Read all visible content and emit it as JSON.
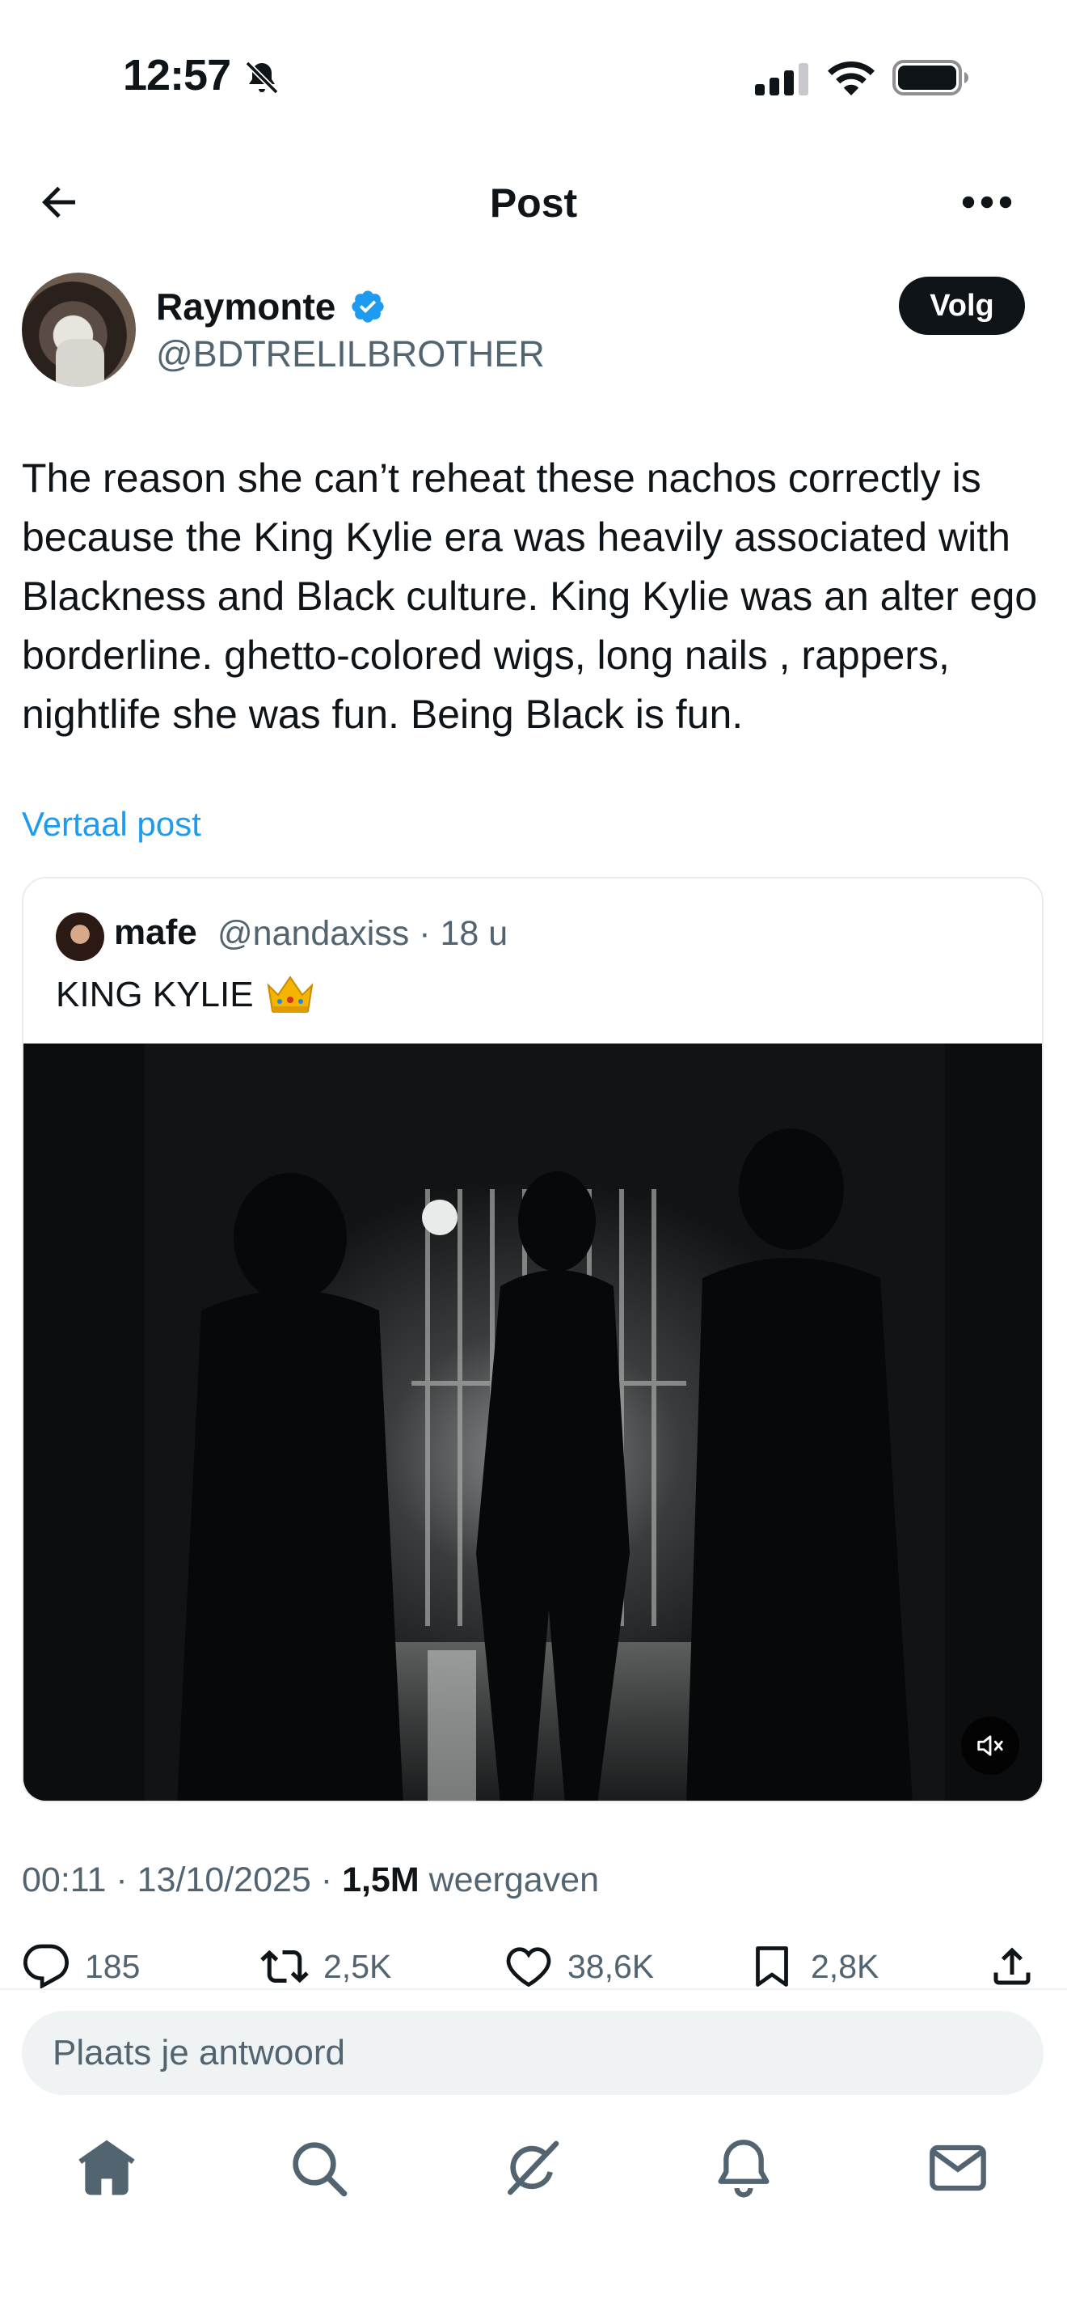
{
  "status_bar": {
    "time": "12:57",
    "icons": [
      "bell-slash-icon",
      "signal-icon",
      "wifi-icon",
      "battery-icon"
    ]
  },
  "header": {
    "title": "Post",
    "back_icon": "arrow-left-icon",
    "more_icon": "more-horizontal-icon"
  },
  "author": {
    "name": "Raymonte",
    "verified": true,
    "handle": "@BDTRELILBROTHER",
    "follow_label": "Volg"
  },
  "post": {
    "text": "The reason she can’t reheat these nachos correctly is because the King Kylie era was heavily associated with Blackness and Black culture. King Kylie was an alter ego borderline. ghetto-colored wigs, long nails , rappers, nightlife she was fun. Being Black is fun.",
    "translate_label": "Vertaal post"
  },
  "quote": {
    "name": "mafe",
    "handle_time": "@nandaxiss · 18 u",
    "text": "KING KYLIE",
    "emoji_icon": "crown-icon",
    "media": "video-thumbnail",
    "mute_icon": "volume-muted-icon"
  },
  "meta": {
    "time_date": "00:11 · 13/10/2025 · ",
    "views_count": "1,5M",
    "views_label": " weergaven"
  },
  "actions": {
    "replies": "185",
    "reposts": "2,5K",
    "likes": "38,6K",
    "bookmarks": "2,8K"
  },
  "reply": {
    "placeholder": "Plaats je antwoord"
  },
  "bottom_nav": {
    "tabs": [
      "home-icon",
      "search-icon",
      "grok-icon",
      "bell-icon",
      "mail-icon"
    ]
  },
  "colors": {
    "accent": "#1d9bf0",
    "text_primary": "#0f1419",
    "text_secondary": "#536471",
    "follow_bg": "#0f1419"
  }
}
